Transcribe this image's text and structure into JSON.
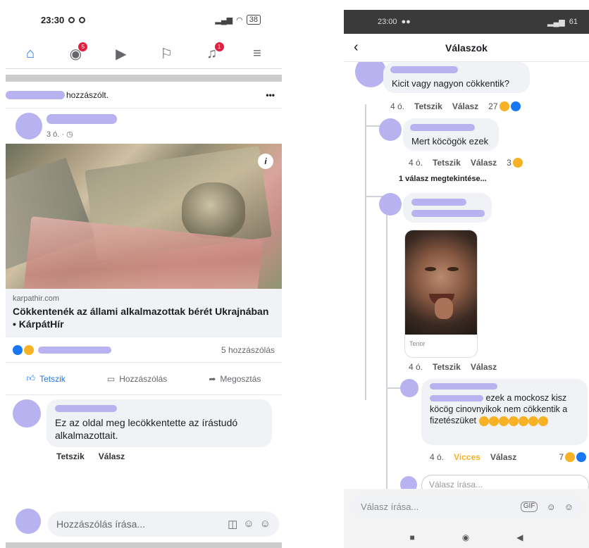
{
  "left": {
    "status_time": "23:30",
    "battery": "38",
    "post_action_text": "hozzászólt.",
    "more": "•••",
    "timestamp": "3 ó. · ",
    "info_glyph": "i",
    "link_source": "karpathir.com",
    "link_title": "Cökkentenék az állami alkalmazottak bérét Ukrajnában • KárpátHír",
    "comment_count": "5 hozzászólás",
    "actions": [
      "Tetszik",
      "Hozzászólás",
      "Megosztás"
    ],
    "comment_text": "Ez az oldal meg lecökkentette az írástudó alkalmazottait.",
    "comment_meta": [
      "Tetszik",
      "Válasz"
    ],
    "compose_placeholder": "Hozzászólás írása...",
    "nav_badges": [
      "5",
      "1"
    ]
  },
  "right": {
    "status_time": "23:00",
    "battery": "61",
    "title": "Válaszok",
    "c1_text": "Kicit vagy nagyon cökkentik?",
    "c1_meta": {
      "age": "4 ó.",
      "like": "Tetszik",
      "reply": "Válasz",
      "count": "27"
    },
    "c2_text": "Mert köcögök ezek",
    "c2_meta": {
      "age": "4 ó.",
      "like": "Tetszik",
      "reply": "Válasz",
      "count": "3"
    },
    "view_replies": "1 válasz megtekintése...",
    "gif_source": "Tenor",
    "c3_meta": {
      "age": "4 ó.",
      "like": "Tetszik",
      "reply": "Válasz"
    },
    "c4_text": "ezek a mockosz kisz köcög  cinovnyikok nem cökkentik a fizetészüket",
    "c4_meta": {
      "age": "4 ó.",
      "reaction": "Vicces",
      "reply": "Válasz",
      "count": "7"
    },
    "reply_placeholder": "Válasz írása...",
    "compose_placeholder": "Válasz írása...",
    "gif_button": "GIF"
  }
}
